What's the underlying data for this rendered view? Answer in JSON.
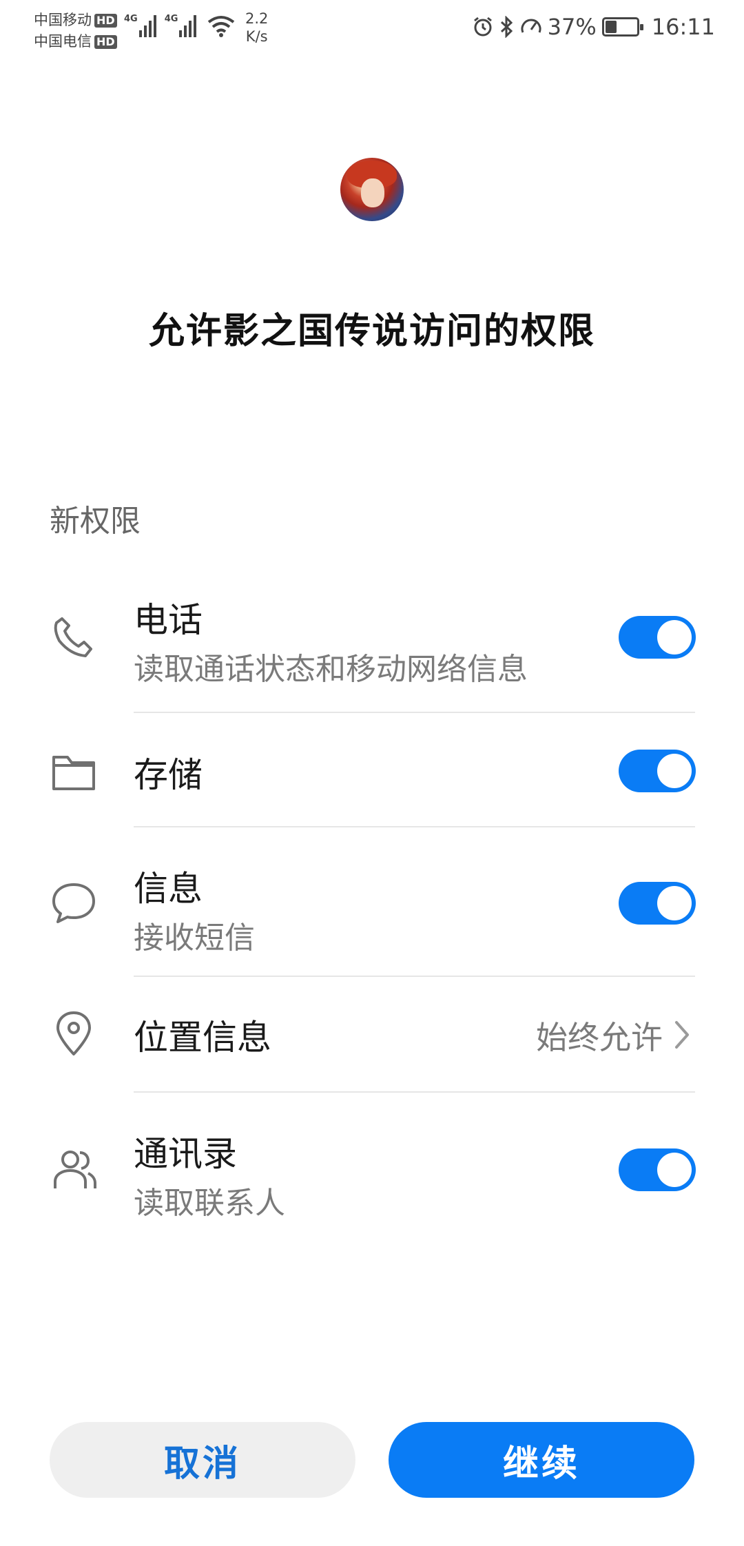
{
  "status_bar": {
    "carrier_1": "中国移动",
    "carrier_2": "中国电信",
    "hd_label": "HD",
    "network_tag": "4G",
    "speed_value": "2.2",
    "speed_unit": "K/s",
    "battery_percent": "37%",
    "battery_level": 0.37,
    "time": "16:11"
  },
  "header": {
    "title": "允许影之国传说访问的权限"
  },
  "section": {
    "label": "新权限"
  },
  "permissions": [
    {
      "icon": "phone-icon",
      "title": "电话",
      "subtitle": "读取通话状态和移动网络信息",
      "enabled": true
    },
    {
      "icon": "folder-icon",
      "title": "存储",
      "enabled": true
    },
    {
      "icon": "message-icon",
      "title": "信息",
      "subtitle": "接收短信",
      "enabled": true
    },
    {
      "icon": "location-icon",
      "title": "位置信息",
      "value": "始终允许"
    },
    {
      "icon": "contacts-icon",
      "title": "通讯录",
      "subtitle": "读取联系人",
      "enabled": true
    }
  ],
  "buttons": {
    "cancel": "取消",
    "continue": "继续"
  },
  "colors": {
    "accent": "#0a7cf5",
    "cancel_text": "#1672d6"
  }
}
